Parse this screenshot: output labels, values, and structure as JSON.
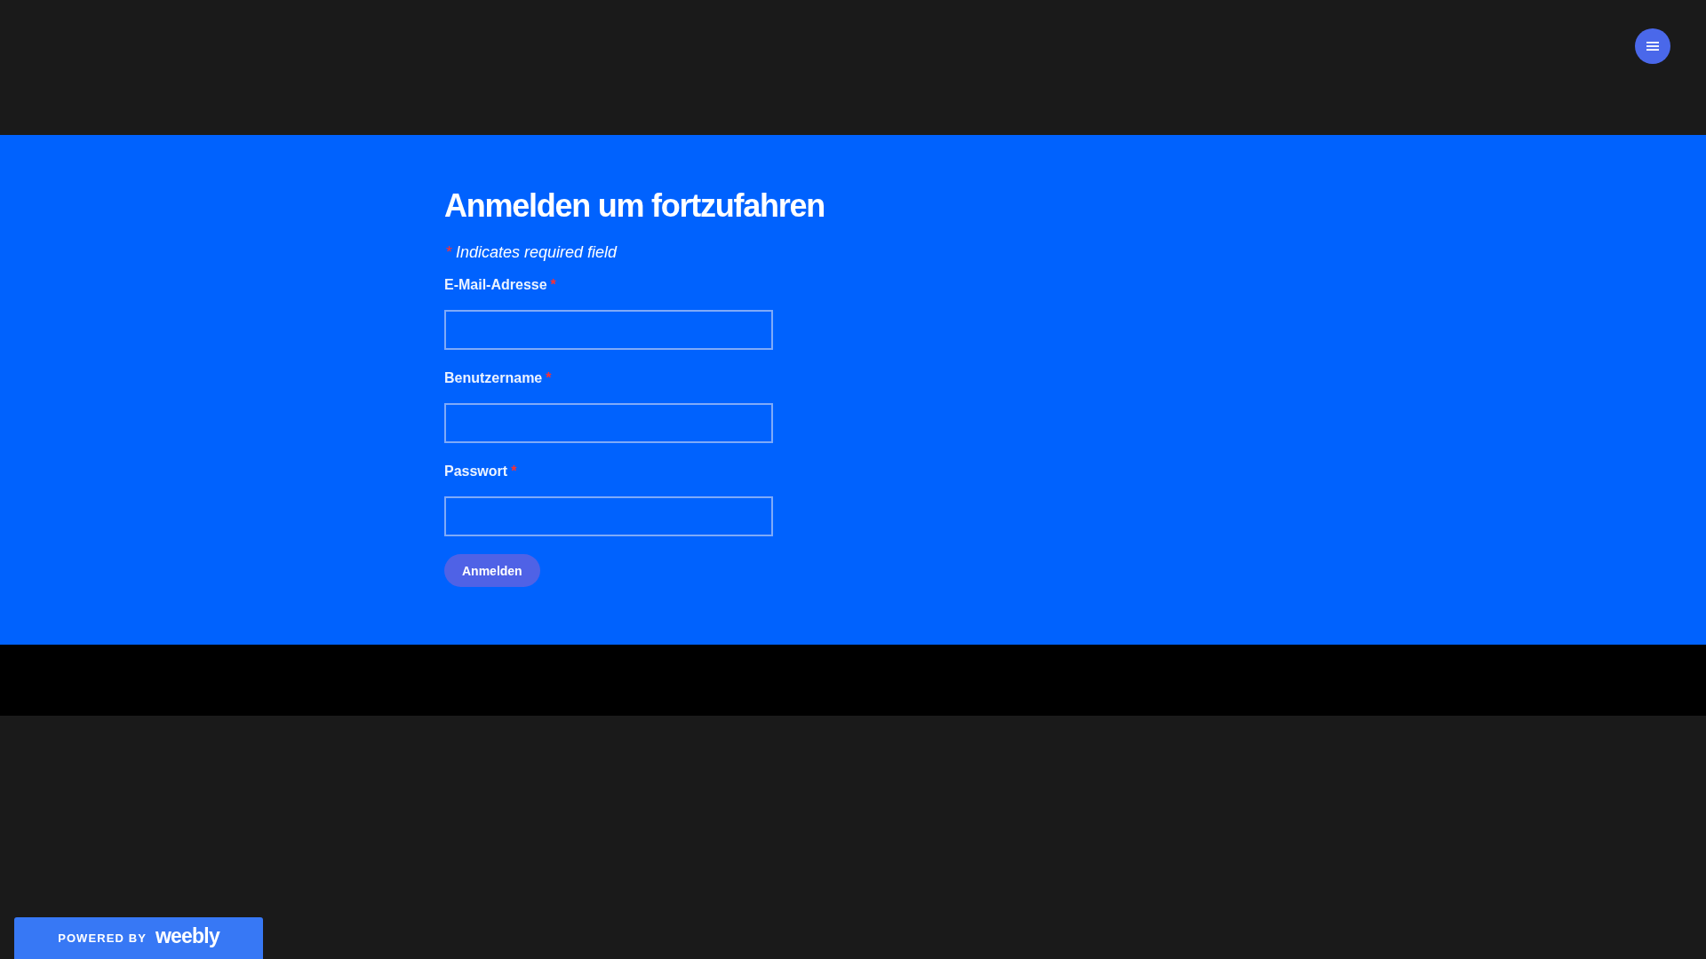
{
  "form": {
    "title": "Anmelden um fortzufahren",
    "required_note": {
      "marker": "*",
      "text": "Indicates required field"
    },
    "fields": [
      {
        "label": "E-Mail-Adresse",
        "required_mark": "*"
      },
      {
        "label": "Benutzername",
        "required_mark": "*"
      },
      {
        "label": "Passwort",
        "required_mark": "*"
      }
    ],
    "submit_button": "Anmelden"
  },
  "footer_badge": {
    "prefix": "POWERED BY",
    "logo": "weebly"
  }
}
